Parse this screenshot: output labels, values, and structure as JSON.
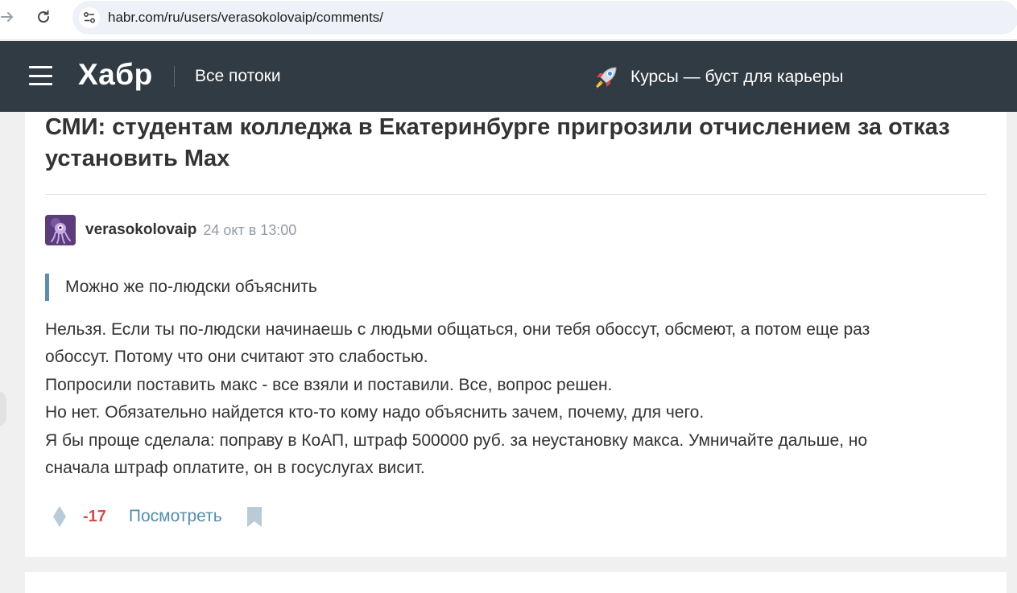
{
  "browser": {
    "url": "habr.com/ru/users/verasokolovaip/comments/",
    "icons": {
      "forward": "forward-arrow-icon",
      "reload": "reload-icon",
      "site_settings": "tune-icon"
    }
  },
  "header": {
    "logo": "Хабр",
    "streams_label": "Все потоки",
    "courses_label": "Курсы — буст для карьеры",
    "icons": {
      "menu": "burger-menu-icon",
      "courses": "rocket-icon"
    }
  },
  "article": {
    "title_lines": [
      "СМИ: студентам колледжа в Екатеринбурге пригрозили отчислением за отказ",
      "установить Max"
    ]
  },
  "comment": {
    "author": "verasokolovaip",
    "time": "24 окт в 13:00",
    "quote": "Можно же по-людски объяснить",
    "lines": [
      "Нельзя. Если ты по-людски начинаешь с людьми общаться, они тебя обоссут, обсмеют, а потом еще раз",
      "обоссут. Потому что они считают это слабостью.",
      "Попросили поставить макс - все взяли и поставили. Все, вопрос решен.",
      "Но нет. Обязательно найдется кто-то кому надо объяснить зачем, почему, для чего.",
      "Я бы проще сделала: поправу в КоАП, штраф 500000 руб. за неустановку макса. Умничайте дальше, но",
      "сначала штраф оплатите, он в госуслугах висит."
    ],
    "score": "-17",
    "view_label": "Посмотреть",
    "icons": {
      "vote": "vote-diamond-icon",
      "bookmark": "bookmark-icon",
      "avatar": "avatar-image"
    }
  },
  "colors": {
    "header_bg": "#303b44",
    "quote_bar": "#5e8eac",
    "negative_score": "#d04e4e",
    "link": "#548eaa"
  }
}
